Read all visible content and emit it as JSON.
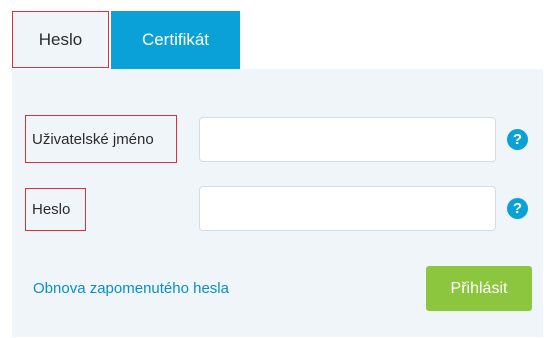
{
  "tabs": {
    "password": "Heslo",
    "certificate": "Certifikát"
  },
  "form": {
    "username_label": "Uživatelské jméno",
    "username_value": "",
    "password_label": "Heslo",
    "password_value": "",
    "help_symbol": "?"
  },
  "footer": {
    "recover_link": "Obnova zapomenutého hesla",
    "login_button": "Přihlásit"
  },
  "colors": {
    "accent": "#0aa0d8",
    "login_button": "#8cc63f",
    "panel_background": "#f0f5fa",
    "highlight_border": "#d9323a"
  },
  "icons": {
    "help": "question-circle-icon"
  }
}
